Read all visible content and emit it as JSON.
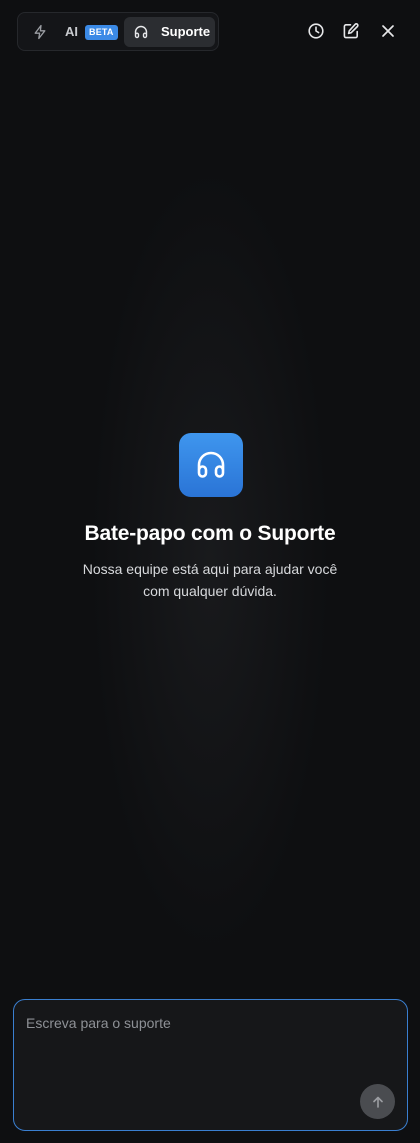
{
  "header": {
    "tabs": {
      "ai": {
        "label": "AI",
        "badge": "BETA",
        "icon": "bolt-icon"
      },
      "support": {
        "label": "Suporte",
        "icon": "headphones-icon",
        "active": true
      }
    },
    "actions": [
      {
        "icon": "history-icon"
      },
      {
        "icon": "edit-icon"
      },
      {
        "icon": "close-icon"
      }
    ]
  },
  "empty_state": {
    "icon": "headphones-icon",
    "title": "Bate-papo com o Suporte",
    "description": "Nossa equipe está aqui para ajudar você com qualquer dúvida."
  },
  "composer": {
    "placeholder": "Escreva para o suporte",
    "value": "",
    "send_icon": "arrow-up-icon"
  },
  "colors": {
    "accent": "#3b8ae6",
    "background": "#0e0f11",
    "badge": "#3b8ae6"
  }
}
